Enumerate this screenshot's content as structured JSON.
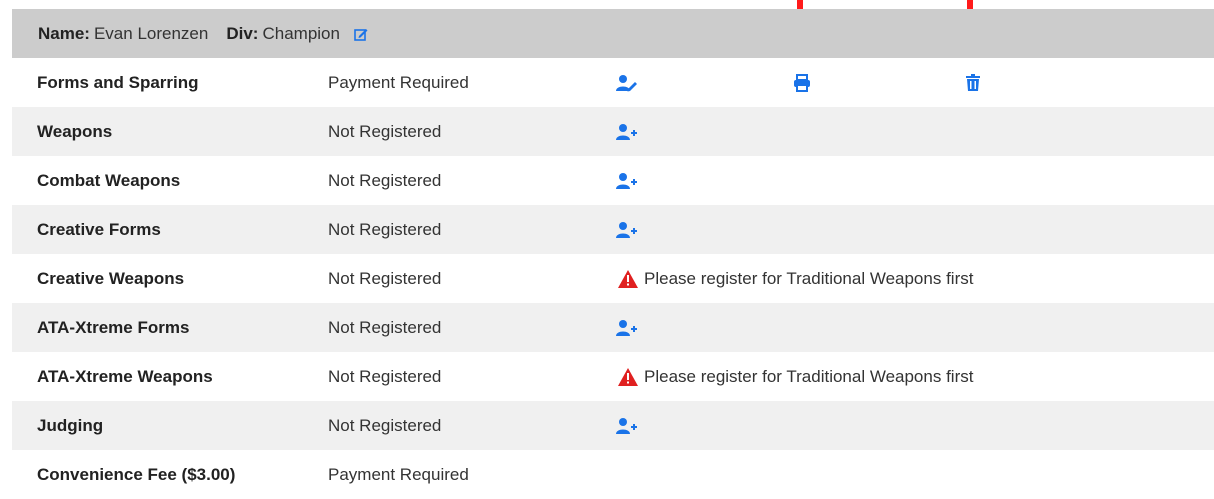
{
  "header": {
    "name_label": "Name:",
    "name_value": "Evan Lorenzen",
    "div_label": "Div:",
    "div_value": "Champion",
    "edit_icon": "edit-icon"
  },
  "rows": [
    {
      "event": "Forms and Sparring",
      "status": "Payment Required",
      "action": "edit-user-icon"
    },
    {
      "event": "Weapons",
      "status": "Not Registered",
      "action": "add-user-icon"
    },
    {
      "event": "Combat Weapons",
      "status": "Not Registered",
      "action": "add-user-icon"
    },
    {
      "event": "Creative Forms",
      "status": "Not Registered",
      "action": "add-user-icon"
    },
    {
      "event": "Creative Weapons",
      "status": "Not Registered",
      "warning": "Please register for Traditional Weapons first"
    },
    {
      "event": "ATA-Xtreme Forms",
      "status": "Not Registered",
      "action": "add-user-icon"
    },
    {
      "event": "ATA-Xtreme Weapons",
      "status": "Not Registered",
      "warning": "Please register for Traditional Weapons first"
    },
    {
      "event": "Judging",
      "status": "Not Registered",
      "action": "add-user-icon"
    },
    {
      "event": "Convenience Fee ($3.00)",
      "status": "Payment Required"
    }
  ],
  "colors": {
    "icon_blue": "#1a73e8",
    "warning_red": "#e02020",
    "annotation_arrow": "#ff1a1a",
    "header_bg": "#cccccc",
    "stripe_bg": "#f0f0f0"
  }
}
